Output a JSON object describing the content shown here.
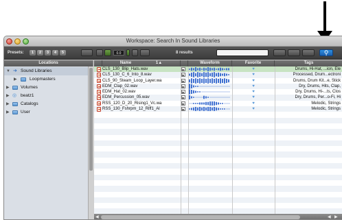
{
  "window": {
    "title": "Workspace: Search In Sound Libraries"
  },
  "toolbar": {
    "presets_label": "Presets:",
    "preset_buttons": [
      "1",
      "2",
      "3",
      "4",
      "5"
    ],
    "volume_value": "0.0",
    "results_text": "8 results",
    "search": {
      "value": "",
      "placeholder": ""
    }
  },
  "locations": {
    "header": "Locations",
    "items": [
      {
        "label": "Sound Libraries",
        "expanded": true,
        "icon": "arrow-icon",
        "indent": 0
      },
      {
        "label": "Loopmasters",
        "expanded": false,
        "icon": "folder-icon",
        "indent": 1
      },
      {
        "label": "Volumes",
        "expanded": false,
        "icon": "folder-icon",
        "indent": 0
      },
      {
        "label": "beatz1",
        "expanded": false,
        "icon": "disc-icon",
        "indent": 0
      },
      {
        "label": "Catalogs",
        "expanded": false,
        "icon": "folder-icon",
        "indent": 0
      },
      {
        "label": "User",
        "expanded": false,
        "icon": "folder-icon",
        "indent": 0
      }
    ]
  },
  "columns": {
    "name": "Name",
    "sort_indicator": "1▲",
    "waveform": "Waveform",
    "favorite": "Favorite",
    "tags": "Tags"
  },
  "files": [
    {
      "name": "CLS_130_Blip_Hats.wav",
      "tags": "Drums, Hi-Hat, ...ion, Ele",
      "favorite": true
    },
    {
      "name": "CLS_130_C_6_Into_8.wav",
      "tags": "Processed, Drum...ectroni",
      "favorite": true
    },
    {
      "name": "CLS_90_Steam_Loop_Layer.wa",
      "tags": "Drums, Drum Kit...e, Stick",
      "favorite": true
    },
    {
      "name": "EDM_Clap_02.wav",
      "tags": "Dry, Drums, Hits, Clap,",
      "favorite": true
    },
    {
      "name": "EDM_Hat_02.wav",
      "tags": "Dry, Drums, Hi-...ts, Clos",
      "favorite": true
    },
    {
      "name": "EDM_Percussion_05.wav",
      "tags": "Dry, Drums, Per...o-Fi, Hi",
      "favorite": true
    },
    {
      "name": "RSS_120_D_20_Rising1_Vc.wa",
      "tags": "Melodic, Strings",
      "favorite": true
    },
    {
      "name": "RSS_130_Fshrpm_12_Riff1_Al",
      "tags": "Melodic, Strings",
      "favorite": true
    }
  ],
  "colors": {
    "selected_row": "#c7e3c3",
    "accent_blue": "#2f8fe0",
    "file_icon_red": "#c23a2a",
    "favorite_blue": "#5a9ad8"
  }
}
